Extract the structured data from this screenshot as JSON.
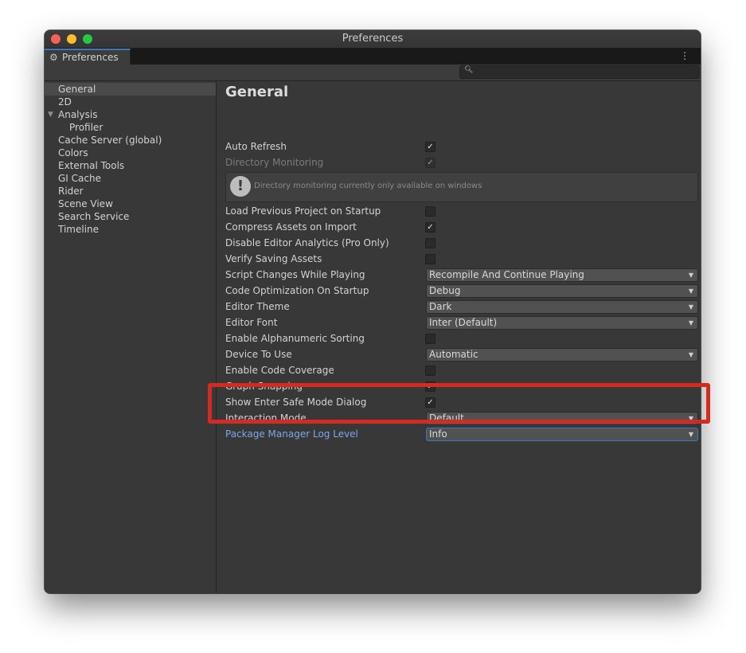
{
  "window": {
    "title": "Preferences"
  },
  "tab": {
    "label": "Preferences",
    "icon": "gear-icon",
    "menu_icon": "kebab-menu-icon"
  },
  "search": {
    "value": "",
    "placeholder": ""
  },
  "sidebar": {
    "items": [
      {
        "label": "General",
        "selected": true
      },
      {
        "label": "2D"
      },
      {
        "label": "Analysis",
        "expanded": true
      },
      {
        "label": "Profiler",
        "indent": 1
      },
      {
        "label": "Cache Server (global)"
      },
      {
        "label": "Colors"
      },
      {
        "label": "External Tools"
      },
      {
        "label": "GI Cache"
      },
      {
        "label": "Rider"
      },
      {
        "label": "Scene View"
      },
      {
        "label": "Search Service"
      },
      {
        "label": "Timeline"
      }
    ]
  },
  "main": {
    "title": "General",
    "rows": [
      {
        "label": "Auto Refresh",
        "type": "checkbox",
        "checked": true
      },
      {
        "label": "Directory Monitoring",
        "type": "checkbox",
        "checked": true,
        "disabled": true
      },
      {
        "label": "Load Previous Project on Startup",
        "type": "checkbox",
        "checked": false
      },
      {
        "label": "Compress Assets on Import",
        "type": "checkbox",
        "checked": true
      },
      {
        "label": "Disable Editor Analytics (Pro Only)",
        "type": "checkbox",
        "checked": false
      },
      {
        "label": "Verify Saving Assets",
        "type": "checkbox",
        "checked": false
      },
      {
        "label": "Script Changes While Playing",
        "type": "dropdown",
        "value": "Recompile And Continue Playing"
      },
      {
        "label": "Code Optimization On Startup",
        "type": "dropdown",
        "value": "Debug"
      },
      {
        "label": "Editor Theme",
        "type": "dropdown",
        "value": "Dark"
      },
      {
        "label": "Editor Font",
        "type": "dropdown",
        "value": "Inter (Default)"
      },
      {
        "label": "Enable Alphanumeric Sorting",
        "type": "checkbox",
        "checked": false
      },
      {
        "label": "Device To Use",
        "type": "dropdown",
        "value": "Automatic"
      },
      {
        "label": "Enable Code Coverage",
        "type": "checkbox",
        "checked": false
      },
      {
        "label": "Graph Snapping",
        "type": "checkbox",
        "checked": true
      },
      {
        "label": "Show Enter Safe Mode Dialog",
        "type": "checkbox",
        "checked": true
      },
      {
        "label": "Interaction Mode",
        "type": "dropdown",
        "value": "Default"
      },
      {
        "label": "Package Manager Log Level",
        "type": "dropdown",
        "value": "Info",
        "focused": true
      }
    ],
    "help": {
      "text": "Directory monitoring currently only available on windows",
      "icon": "warning-icon"
    }
  },
  "colors": {
    "highlight": "#d32b22",
    "accent": "#3a79bb",
    "focused_label": "#7ba8e6"
  },
  "icons": {
    "check": "✓",
    "dropdown_arrow": "▼"
  }
}
